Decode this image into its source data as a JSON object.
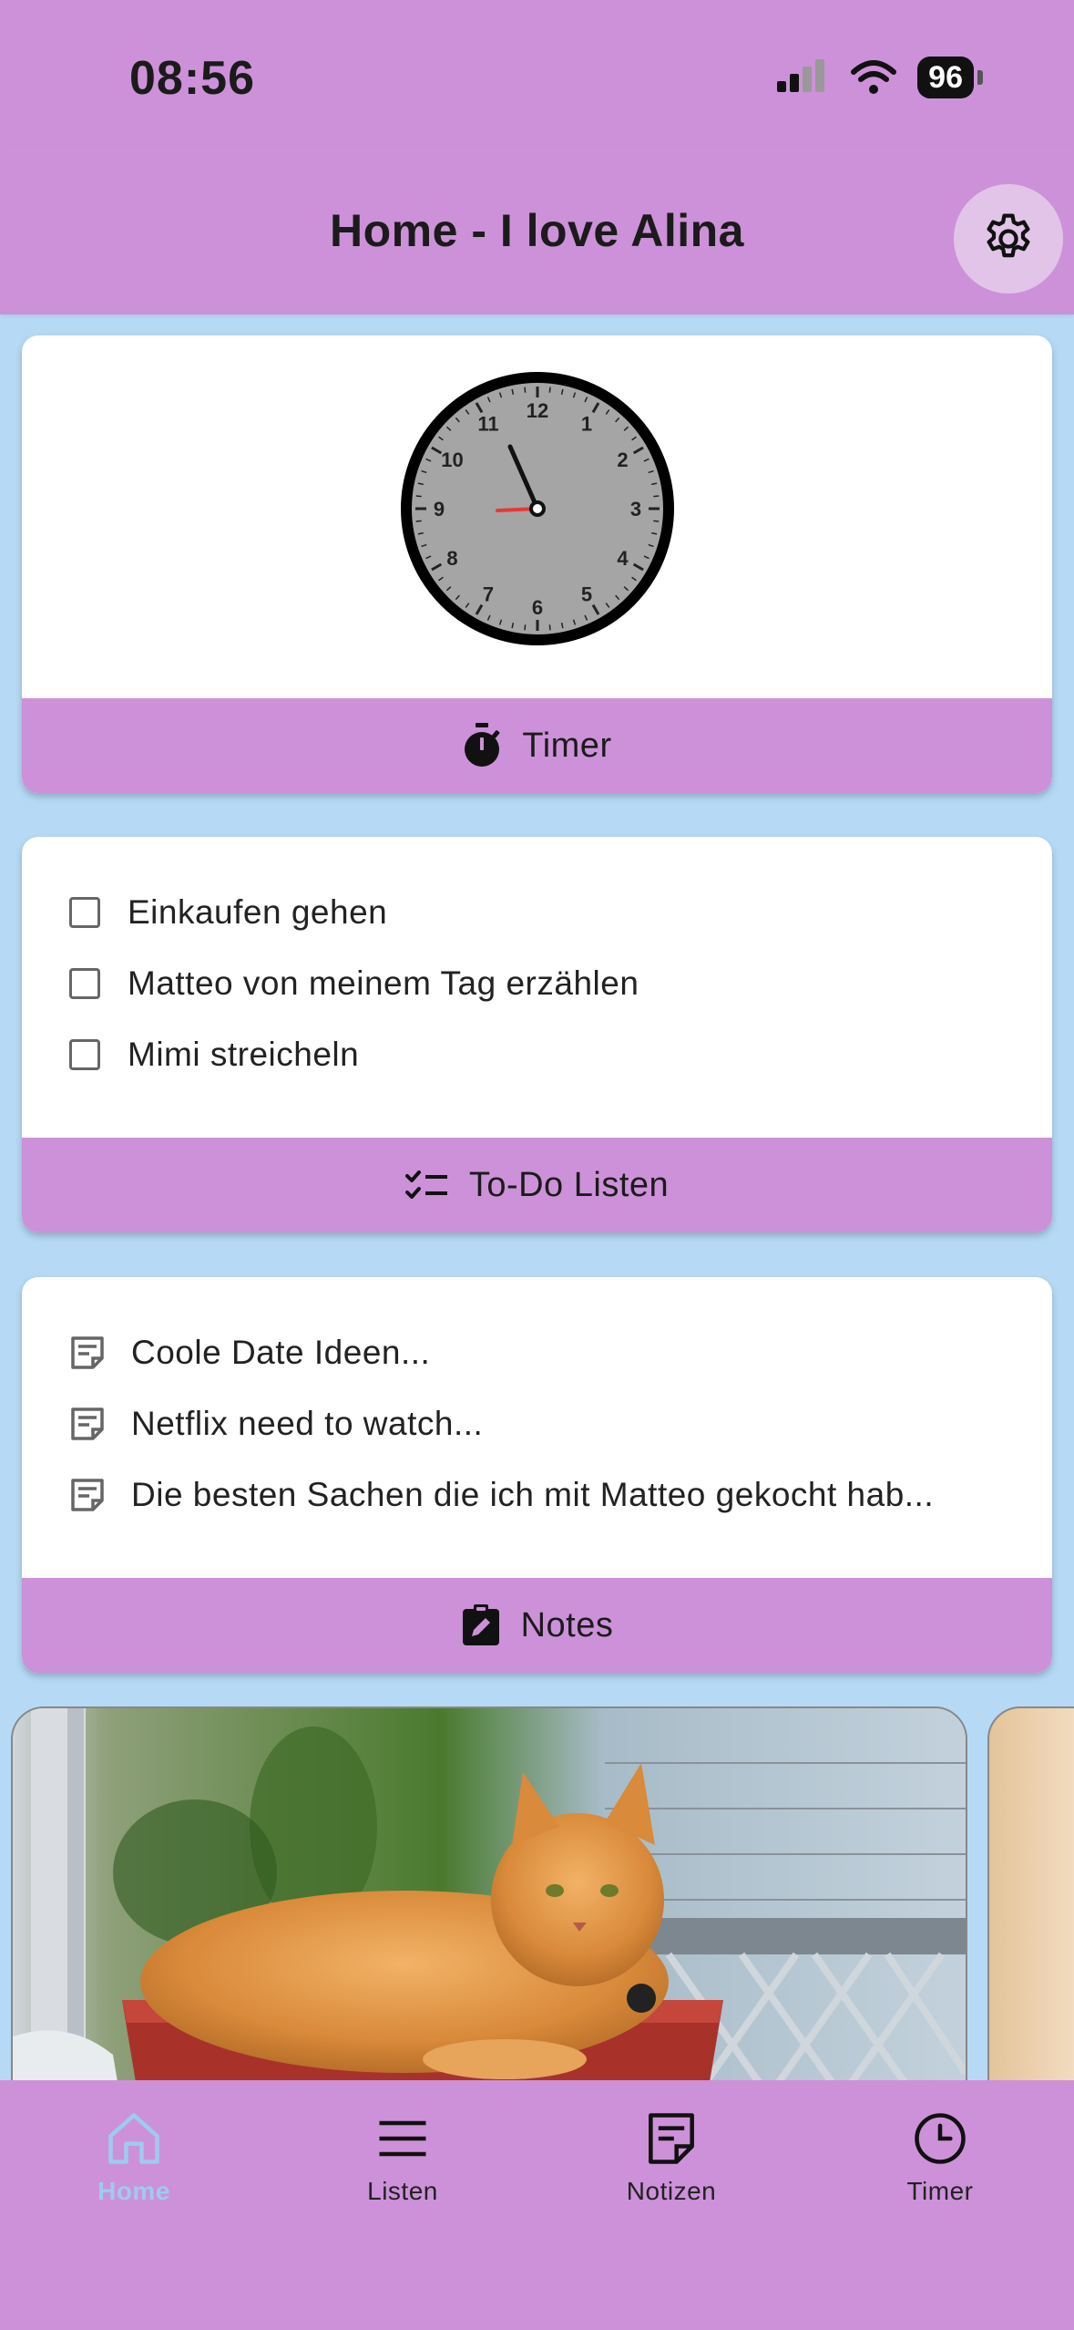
{
  "status_bar": {
    "time": "08:56",
    "battery": "96"
  },
  "app_bar": {
    "title": "Home - I love Alina"
  },
  "clock_card": {
    "numbers": [
      "12",
      "1",
      "2",
      "3",
      "4",
      "5",
      "6",
      "7",
      "8",
      "9",
      "10",
      "11"
    ],
    "footer_label": "Timer"
  },
  "todo_card": {
    "items": [
      "Einkaufen gehen",
      "Matteo von meinem Tag erzählen",
      "Mimi streicheln"
    ],
    "footer_label": "To-Do Listen"
  },
  "notes_card": {
    "items": [
      "Coole Date Ideen...",
      "Netflix need to watch...",
      "Die besten Sachen die ich mit Matteo gekocht hab..."
    ],
    "footer_label": "Notes"
  },
  "bottom_nav": {
    "items": [
      {
        "label": "Home",
        "icon": "home-icon",
        "active": true
      },
      {
        "label": "Listen",
        "icon": "menu-icon",
        "active": false
      },
      {
        "label": "Notizen",
        "icon": "note-icon",
        "active": false
      },
      {
        "label": "Timer",
        "icon": "clock-icon",
        "active": false
      }
    ]
  },
  "colors": {
    "accent": "#cd91d9",
    "background": "#b6daf6",
    "active_nav": "#9ecbf0",
    "second_hand": "#e53935"
  }
}
